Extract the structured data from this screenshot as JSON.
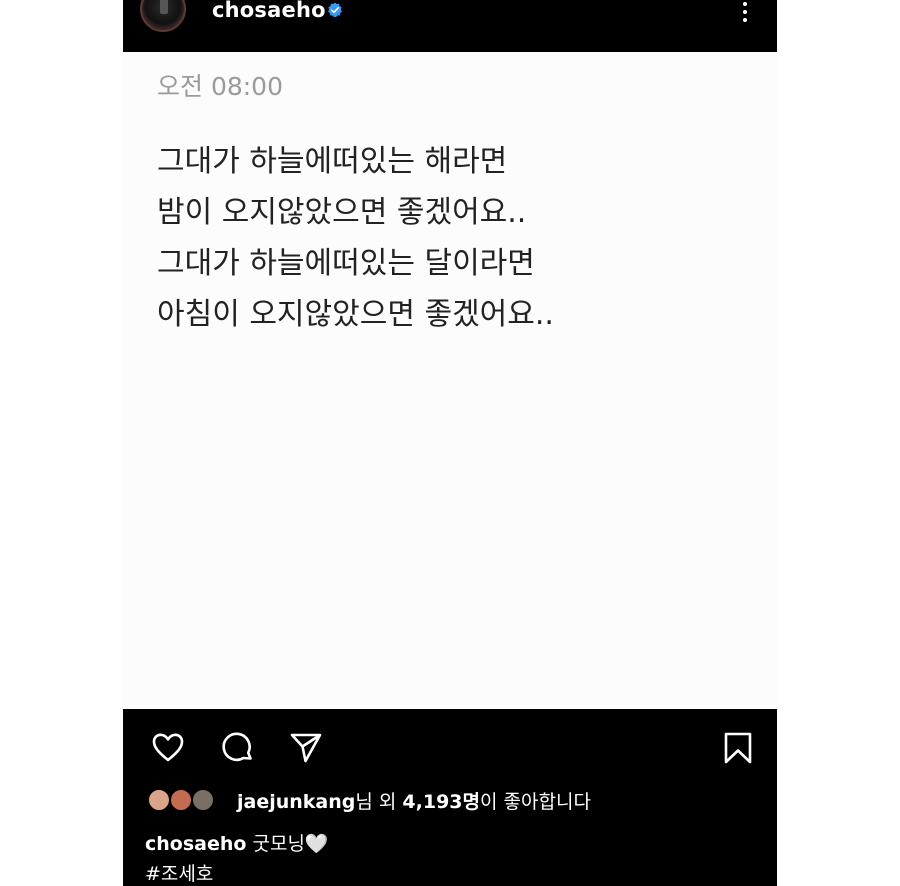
{
  "header": {
    "username": "chosaeho",
    "verified_icon": "verified-badge-icon",
    "more_icon": "more-vertical-icon"
  },
  "post": {
    "time": "오전 08:00",
    "lines": [
      "그대가 하늘에떠있는 해라면",
      "밤이 오지않았으면 좋겠어요..",
      "그대가 하늘에떠있는 달이라면",
      "아침이 오지않았으면 좋겠어요.."
    ]
  },
  "actions": {
    "like_icon": "heart-icon",
    "comment_icon": "comment-icon",
    "share_icon": "send-icon",
    "save_icon": "bookmark-icon"
  },
  "likes": {
    "user": "jaejunkang",
    "suffix_a": "님 외 ",
    "count": "4,193명",
    "suffix_b": "이 좋아합니다"
  },
  "caption": {
    "username": "chosaeho",
    "text": " 굿모닝🤍"
  },
  "hashtag": "#조세호",
  "colors": {
    "background": "#000000",
    "post_background": "#fcfcfd",
    "verified": "#3897f0"
  }
}
